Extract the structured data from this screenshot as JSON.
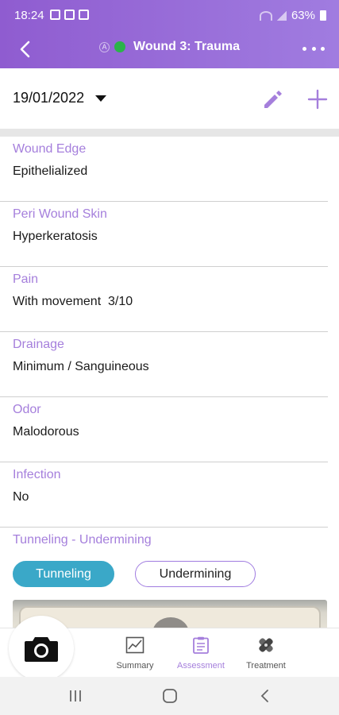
{
  "status_bar": {
    "time": "18:24",
    "battery": "63%"
  },
  "app_bar": {
    "title": "Wound 3: Trauma",
    "status_letter": "A"
  },
  "date_selector": {
    "value": "19/01/2022"
  },
  "fields": [
    {
      "label": "Wound Edge",
      "value": "Epithelialized"
    },
    {
      "label": "Peri Wound Skin",
      "value": "Hyperkeratosis"
    },
    {
      "label": "Pain",
      "value": "With movement  3/10"
    },
    {
      "label": "Drainage",
      "value": "Minimum / Sanguineous"
    },
    {
      "label": "Odor",
      "value": "Malodorous"
    },
    {
      "label": "Infection",
      "value": "No"
    },
    {
      "label": "Tunneling - Undermining",
      "value": ""
    }
  ],
  "toggle": {
    "tunneling": "Tunneling",
    "undermining": "Undermining",
    "active": "Tunneling"
  },
  "bottom_nav": {
    "summary": "Summary",
    "assessment": "Assessment",
    "treatment": "Treatment",
    "active": "Assessment"
  },
  "colors": {
    "header": "#9b6fd6",
    "accent": "#a57fdc",
    "toggle_active": "#3aa8c8",
    "online": "#2bb34a"
  }
}
